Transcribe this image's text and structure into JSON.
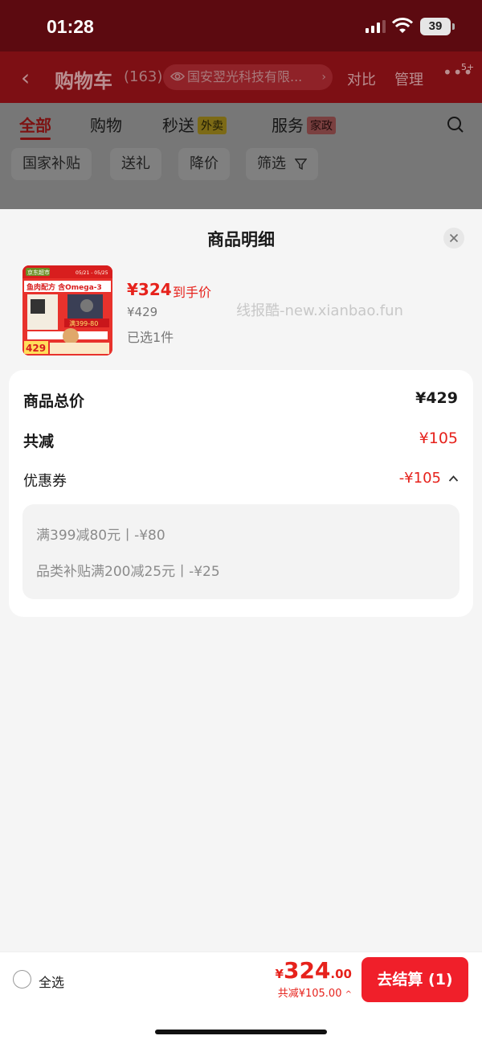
{
  "status_bar": {
    "time": "01:28",
    "battery": "39"
  },
  "nav": {
    "title": "购物车",
    "count": "(163)",
    "store": "国安翌光科技有限...",
    "compare": "对比",
    "manage": "管理",
    "more_badge": "5+"
  },
  "tabs": [
    {
      "label": "全部"
    },
    {
      "label": "购物"
    },
    {
      "label": "秒送",
      "tag": "外卖"
    },
    {
      "label": "服务",
      "tag": "家政"
    }
  ],
  "filters": [
    "国家补贴",
    "送礼",
    "降价",
    "筛选"
  ],
  "sheet": {
    "title": "商品明细",
    "product": {
      "final_price": "¥324",
      "final_label": "到手价",
      "original_price": "¥429",
      "selected": "已选1件",
      "thumb": {
        "brand": "京东超市",
        "dates": "05/21 - 05/25",
        "headline": "鱼肉配方 含Omega-3",
        "promo": "满399-80",
        "price": "429"
      }
    },
    "watermark": "线报酷-new.xianbao.fun",
    "summary": {
      "total_label": "商品总价",
      "total_value": "¥429",
      "reduce_label": "共减",
      "reduce_value": "¥105",
      "coupon_label": "优惠券",
      "coupon_value": "-¥105",
      "coupons": [
        "满399减80元丨-¥80",
        "品类补贴满200减25元丨-¥25"
      ]
    }
  },
  "bottom": {
    "select_all": "全选",
    "currency": "¥",
    "total_int": "324",
    "total_dec": ".00",
    "saving": "共减¥105.00",
    "checkout": "去结算 (1)"
  },
  "colors": {
    "accent_red": "#e6221c",
    "checkout_red": "#f01f2a"
  }
}
